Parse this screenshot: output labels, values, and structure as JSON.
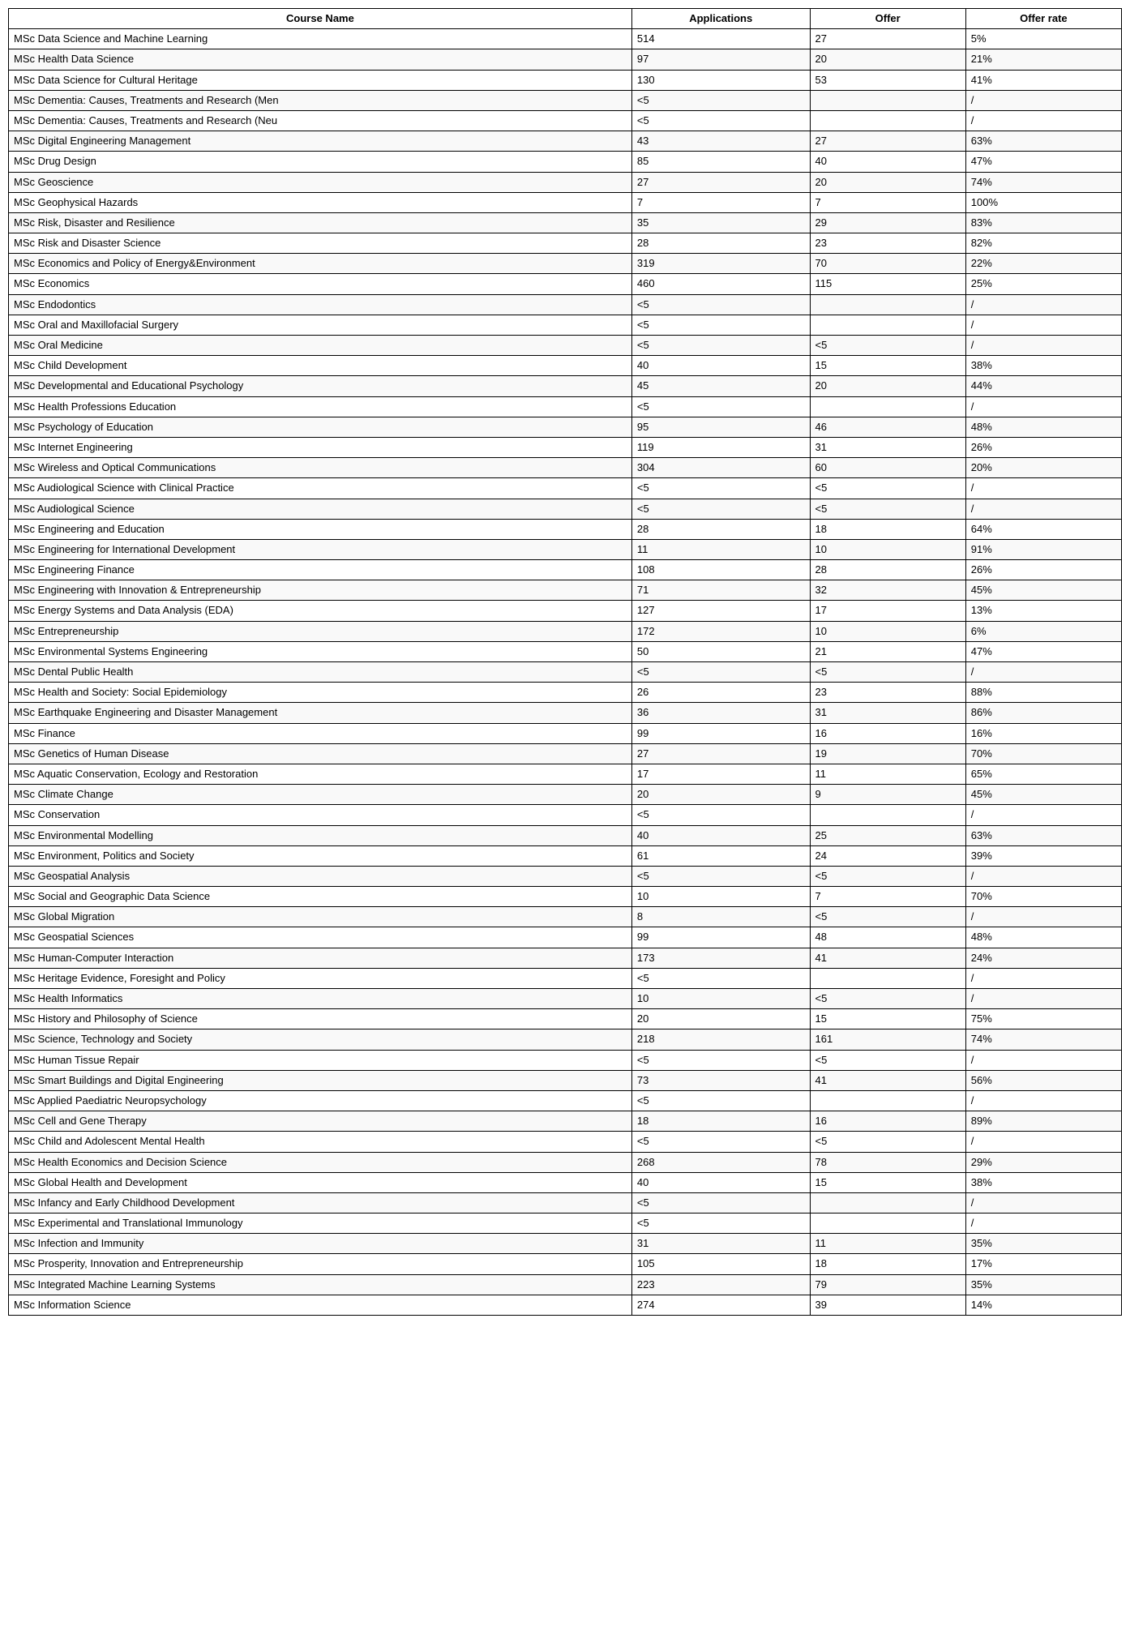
{
  "table": {
    "headers": [
      "Course Name",
      "Applications",
      "Offer",
      "Offer rate"
    ],
    "rows": [
      [
        "MSc Data Science and Machine Learning",
        "514",
        "27",
        "5%"
      ],
      [
        "MSc Health Data Science",
        "97",
        "20",
        "21%"
      ],
      [
        "MSc Data Science for Cultural Heritage",
        "130",
        "53",
        "41%"
      ],
      [
        "MSc Dementia: Causes, Treatments and Research (Men",
        "<5",
        "",
        "/"
      ],
      [
        "MSc Dementia: Causes, Treatments and Research (Neu",
        "<5",
        "",
        "/"
      ],
      [
        "MSc Digital Engineering Management",
        "43",
        "27",
        "63%"
      ],
      [
        "MSc Drug Design",
        "85",
        "40",
        "47%"
      ],
      [
        "MSc Geoscience",
        "27",
        "20",
        "74%"
      ],
      [
        "MSc Geophysical Hazards",
        "7",
        "7",
        "100%"
      ],
      [
        "MSc Risk, Disaster and Resilience",
        "35",
        "29",
        "83%"
      ],
      [
        "MSc Risk and Disaster Science",
        "28",
        "23",
        "82%"
      ],
      [
        "MSc Economics and Policy of Energy&Environment",
        "319",
        "70",
        "22%"
      ],
      [
        "MSc Economics",
        "460",
        "115",
        "25%"
      ],
      [
        "MSc Endodontics",
        "<5",
        "",
        "/"
      ],
      [
        "MSc Oral and Maxillofacial Surgery",
        "<5",
        "",
        "/"
      ],
      [
        "MSc Oral Medicine",
        "<5",
        "<5",
        "/"
      ],
      [
        "MSc Child Development",
        "40",
        "15",
        "38%"
      ],
      [
        "MSc Developmental and Educational Psychology",
        "45",
        "20",
        "44%"
      ],
      [
        "MSc Health Professions Education",
        "<5",
        "",
        "/"
      ],
      [
        "MSc Psychology of Education",
        "95",
        "46",
        "48%"
      ],
      [
        "MSc Internet Engineering",
        "119",
        "31",
        "26%"
      ],
      [
        "MSc Wireless and Optical Communications",
        "304",
        "60",
        "20%"
      ],
      [
        "MSc Audiological Science with Clinical Practice",
        "<5",
        "<5",
        "/"
      ],
      [
        "MSc Audiological Science",
        "<5",
        "<5",
        "/"
      ],
      [
        "MSc Engineering and Education",
        "28",
        "18",
        "64%"
      ],
      [
        "MSc Engineering for International Development",
        "11",
        "10",
        "91%"
      ],
      [
        "MSc Engineering Finance",
        "108",
        "28",
        "26%"
      ],
      [
        "MSc Engineering with Innovation & Entrepreneurship",
        "71",
        "32",
        "45%"
      ],
      [
        "MSc Energy Systems and Data Analysis (EDA)",
        "127",
        "17",
        "13%"
      ],
      [
        "MSc Entrepreneurship",
        "172",
        "10",
        "6%"
      ],
      [
        "MSc Environmental Systems Engineering",
        "50",
        "21",
        "47%"
      ],
      [
        "MSc Dental Public Health",
        "<5",
        "<5",
        "/"
      ],
      [
        "MSc Health and Society: Social Epidemiology",
        "26",
        "23",
        "88%"
      ],
      [
        "MSc Earthquake Engineering and Disaster Management",
        "36",
        "31",
        "86%"
      ],
      [
        "MSc Finance",
        "99",
        "16",
        "16%"
      ],
      [
        "MSc Genetics of Human Disease",
        "27",
        "19",
        "70%"
      ],
      [
        "MSc Aquatic Conservation, Ecology and Restoration",
        "17",
        "11",
        "65%"
      ],
      [
        "MSc Climate Change",
        "20",
        "9",
        "45%"
      ],
      [
        "MSc Conservation",
        "<5",
        "",
        "/"
      ],
      [
        "MSc Environmental Modelling",
        "40",
        "25",
        "63%"
      ],
      [
        "MSc Environment, Politics and Society",
        "61",
        "24",
        "39%"
      ],
      [
        "MSc Geospatial Analysis",
        "<5",
        "<5",
        "/"
      ],
      [
        "MSc Social and Geographic Data Science",
        "10",
        "7",
        "70%"
      ],
      [
        "MSc Global Migration",
        "8",
        "<5",
        "/"
      ],
      [
        "MSc Geospatial Sciences",
        "99",
        "48",
        "48%"
      ],
      [
        "MSc Human-Computer Interaction",
        "173",
        "41",
        "24%"
      ],
      [
        "MSc Heritage Evidence, Foresight and Policy",
        "<5",
        "",
        "/"
      ],
      [
        "MSc Health Informatics",
        "10",
        "<5",
        "/"
      ],
      [
        "MSc History and Philosophy of Science",
        "20",
        "15",
        "75%"
      ],
      [
        "MSc Science, Technology and Society",
        "218",
        "161",
        "74%"
      ],
      [
        "MSc Human Tissue Repair",
        "<5",
        "<5",
        "/"
      ],
      [
        "MSc Smart Buildings and Digital Engineering",
        "73",
        "41",
        "56%"
      ],
      [
        "MSc Applied Paediatric Neuropsychology",
        "<5",
        "",
        "/"
      ],
      [
        "MSc Cell and Gene Therapy",
        "18",
        "16",
        "89%"
      ],
      [
        "MSc Child and Adolescent Mental Health",
        "<5",
        "<5",
        "/"
      ],
      [
        "MSc Health Economics and Decision Science",
        "268",
        "78",
        "29%"
      ],
      [
        "MSc Global Health and Development",
        "40",
        "15",
        "38%"
      ],
      [
        "MSc Infancy and Early Childhood Development",
        "<5",
        "",
        "/"
      ],
      [
        "MSc Experimental and Translational Immunology",
        "<5",
        "",
        "/"
      ],
      [
        "MSc Infection and Immunity",
        "31",
        "11",
        "35%"
      ],
      [
        "MSc Prosperity, Innovation and Entrepreneurship",
        "105",
        "18",
        "17%"
      ],
      [
        "MSc Integrated Machine Learning Systems",
        "223",
        "79",
        "35%"
      ],
      [
        "MSc Information Science",
        "274",
        "39",
        "14%"
      ]
    ]
  }
}
